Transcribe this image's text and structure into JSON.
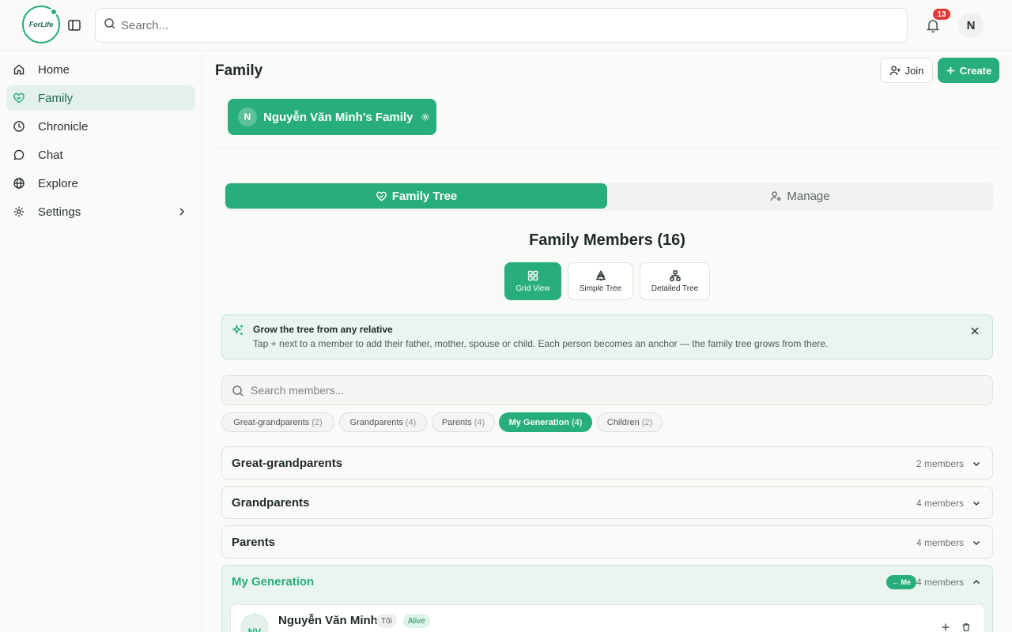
{
  "app": {
    "logo_text": "ForLife"
  },
  "topbar": {
    "search_placeholder": "Search...",
    "notification_count": "13",
    "user_initial": "N"
  },
  "sidebar": {
    "items": [
      {
        "label": "Home",
        "icon": "home-icon"
      },
      {
        "label": "Family",
        "icon": "heart-handshake-icon",
        "active": true
      },
      {
        "label": "Chronicle",
        "icon": "clock-icon"
      },
      {
        "label": "Chat",
        "icon": "chat-bubble-icon"
      },
      {
        "label": "Explore",
        "icon": "globe-icon"
      },
      {
        "label": "Settings",
        "icon": "gear-icon",
        "has_submenu": true
      }
    ]
  },
  "main": {
    "title": "Family",
    "join_label": "Join",
    "create_label": "Create",
    "family_chip": {
      "initial": "N",
      "name": "Nguyễn Văn Minh's Family"
    },
    "tabs": [
      {
        "label": "Family Tree",
        "active": true
      },
      {
        "label": "Manage"
      }
    ],
    "members_title": "Family Members (16)",
    "views": [
      {
        "label": "Grid View",
        "active": true
      },
      {
        "label": "Simple Tree"
      },
      {
        "label": "Detailed Tree"
      }
    ],
    "info": {
      "title": "Grow the tree from any relative",
      "text": "Tap + next to a member to add their father, mother, spouse or child. Each person becomes an anchor — the family tree grows from there."
    },
    "member_search_placeholder": "Search members...",
    "filters": [
      {
        "label": "Great-grandparents",
        "count": "(2)"
      },
      {
        "label": "Grandparents",
        "count": "(4)"
      },
      {
        "label": "Parents",
        "count": "(4)"
      },
      {
        "label": "My Generation",
        "count": "(4)",
        "active": true
      },
      {
        "label": "Children",
        "count": "(2)"
      }
    ],
    "groups": [
      {
        "name": "Great-grandparents",
        "count": "2 members"
      },
      {
        "name": "Grandparents",
        "count": "4 members"
      },
      {
        "name": "Parents",
        "count": "4 members"
      },
      {
        "name": "My Generation",
        "count": "4 members",
        "badge": "← Me",
        "open": true
      }
    ],
    "member": {
      "initials": "NV",
      "name": "Nguyễn Văn Minh",
      "tag_self": "Tôi",
      "tag_status": "Alive"
    }
  },
  "colors": {
    "accent": "#27ae7a",
    "accent_light": "#eaf5ef",
    "badge_red": "#e53935"
  }
}
